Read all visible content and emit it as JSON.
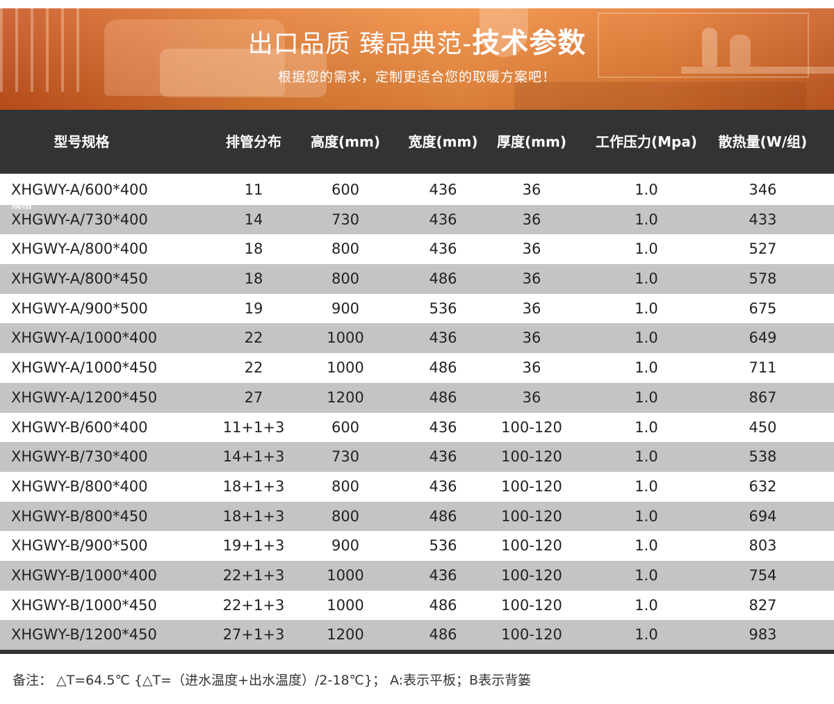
{
  "banner": {
    "title_regular": "出口品质  臻品典范-",
    "title_bold": "技术参数",
    "subtitle": "根据您的需求，定制更适合您的取暖方案吧！"
  },
  "table": {
    "headers": [
      "型号规格",
      "排管分布",
      "高度(mm)",
      "宽度(mm)",
      "厚度(mm)",
      "工作压力(Mpa)",
      "散热量(W/组)"
    ],
    "ghost_text": "规格",
    "rows": [
      [
        "XHGWY-A/600*400",
        "11",
        "600",
        "436",
        "36",
        "1.0",
        "346"
      ],
      [
        "XHGWY-A/730*400",
        "14",
        "730",
        "436",
        "36",
        "1.0",
        "433"
      ],
      [
        "XHGWY-A/800*400",
        "18",
        "800",
        "436",
        "36",
        "1.0",
        "527"
      ],
      [
        "XHGWY-A/800*450",
        "18",
        "800",
        "486",
        "36",
        "1.0",
        "578"
      ],
      [
        "XHGWY-A/900*500",
        "19",
        "900",
        "536",
        "36",
        "1.0",
        "675"
      ],
      [
        "XHGWY-A/1000*400",
        "22",
        "1000",
        "436",
        "36",
        "1.0",
        "649"
      ],
      [
        "XHGWY-A/1000*450",
        "22",
        "1000",
        "486",
        "36",
        "1.0",
        "711"
      ],
      [
        "XHGWY-A/1200*450",
        "27",
        "1200",
        "486",
        "36",
        "1.0",
        "867"
      ],
      [
        "XHGWY-B/600*400",
        "11+1+3",
        "600",
        "436",
        "100-120",
        "1.0",
        "450"
      ],
      [
        "XHGWY-B/730*400",
        "14+1+3",
        "730",
        "436",
        "100-120",
        "1.0",
        "538"
      ],
      [
        "XHGWY-B/800*400",
        "18+1+3",
        "800",
        "436",
        "100-120",
        "1.0",
        "632"
      ],
      [
        "XHGWY-B/800*450",
        "18+1+3",
        "800",
        "486",
        "100-120",
        "1.0",
        "694"
      ],
      [
        "XHGWY-B/900*500",
        "19+1+3",
        "900",
        "536",
        "100-120",
        "1.0",
        "803"
      ],
      [
        "XHGWY-B/1000*400",
        "22+1+3",
        "1000",
        "436",
        "100-120",
        "1.0",
        "754"
      ],
      [
        "XHGWY-B/1000*450",
        "22+1+3",
        "1000",
        "486",
        "100-120",
        "1.0",
        "827"
      ],
      [
        "XHGWY-B/1200*450",
        "27+1+3",
        "1200",
        "486",
        "100-120",
        "1.0",
        "983"
      ]
    ]
  },
  "note": "备注：  △T=64.5℃ {△T=（进水温度+出水温度）/2-18℃}；   A:表示平板；B表示背篓",
  "colors": {
    "banner_orange": "#f08c3e",
    "header_bg": "#333333",
    "stripe_row": "#c4c4c4",
    "text": "#222222"
  }
}
